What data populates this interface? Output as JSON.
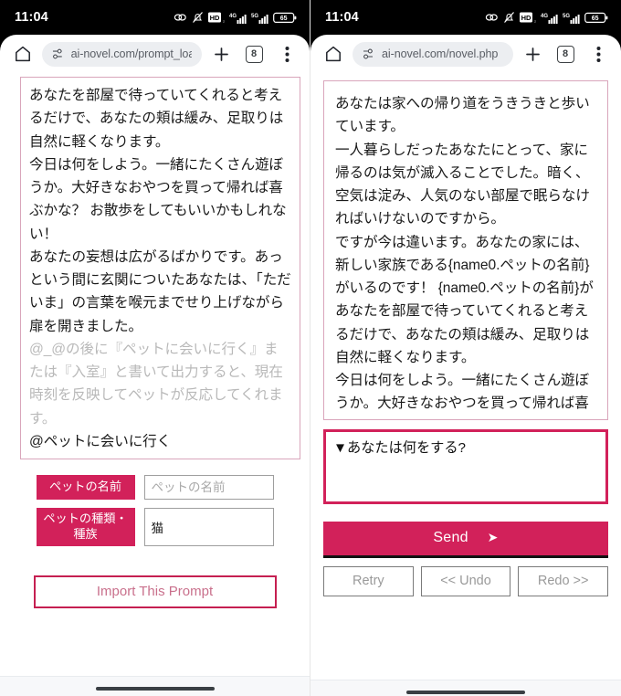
{
  "status_bar": {
    "time": "11:04",
    "battery_level": "65",
    "icons": [
      "link-icon",
      "mute-bell-icon",
      "hd-voice-icon",
      "4g-signal-icon",
      "5g-signal-icon",
      "battery-icon"
    ]
  },
  "panels": [
    {
      "id": "prompt-loader",
      "browser": {
        "url": "ai-novel.com/prompt_loa",
        "tab_count": "8",
        "home_icon": "home-icon",
        "page_info_icon": "page-settings-icon",
        "new_tab_icon": "plus-icon",
        "menu_icon": "overflow-menu-icon"
      },
      "novel_text_main": "あなたを部屋で待っていてくれると考えるだけで、あなたの頬は緩み、足取りは自然に軽くなります。\n今日は何をしよう。一緒にたくさん遊ぼうか。大好きなおやつを買って帰れば喜ぶかな？ お散歩をしてもいいかもしれない！\nあなたの妄想は広がるばかりです。あっという間に玄関についたあなたは、「ただいま」の言葉を喉元までせり上げながら扉を開きました。",
      "novel_text_dim": "\n@_@の後に『ペットに会いに行く』または『入室』と書いて出力すると、現在時刻を反映してペットが反応してくれます。",
      "novel_text_tail": "\n@ペットに会いに行く",
      "form": {
        "rows": [
          {
            "label": "ペットの名前",
            "value": "",
            "placeholder": "ペットの名前"
          },
          {
            "label": "ペットの種類・種族",
            "value": "猫",
            "placeholder": ""
          }
        ],
        "import_button": "Import This Prompt"
      }
    },
    {
      "id": "novel-player",
      "browser": {
        "url": "ai-novel.com/novel.php",
        "tab_count": "8",
        "home_icon": "home-icon",
        "page_info_icon": "page-settings-icon",
        "new_tab_icon": "plus-icon",
        "menu_icon": "overflow-menu-icon"
      },
      "novel_text_main": "あなたは家への帰り道をうきうきと歩いています。\n一人暮らしだったあなたにとって、家に帰るのは気が滅入ることでした。暗く、空気は淀み、人気のない部屋で眠らなければいけないのですから。\nですが今は違います。あなたの家には、新しい家族である{name0.ペットの名前}がいるのです！ {name0.ペットの名前}があなたを部屋で待っていてくれると考えるだけで、あなたの頬は緩み、足取りは自然に軽くなります。\n今日は何をしよう。一緒にたくさん遊ぼうか。大好きなおやつを買って帰れば喜",
      "answer_box_value": "▼あなたは何をする?",
      "send_button": "Send",
      "send_icon": "send-arrow-icon",
      "nav_buttons": [
        "Retry",
        "<< Undo",
        "Redo >>"
      ]
    }
  ],
  "colors": {
    "accent_pink": "#d2215a",
    "card_border": "#d9a5bb",
    "import_border": "#c51f51",
    "import_text": "#c9708c",
    "dim_text": "#b9b9b9"
  }
}
